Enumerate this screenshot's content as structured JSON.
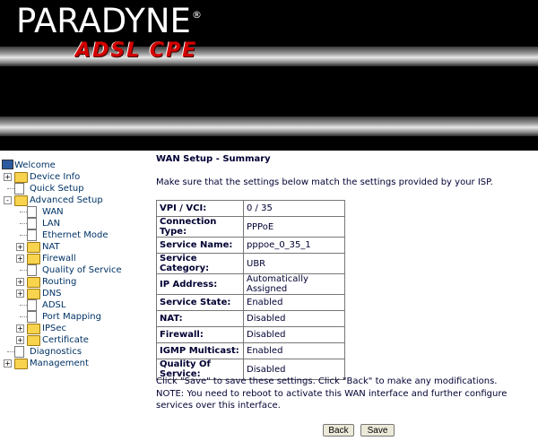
{
  "header": {
    "brand": "PARADYNE",
    "reg": "®",
    "product": "ADSL CPE"
  },
  "nav": {
    "items": [
      {
        "label": "Welcome",
        "kind": "root",
        "icon": "monitor-icon"
      },
      {
        "label": "Device Info",
        "kind": "folder",
        "expander": "+"
      },
      {
        "label": "Quick Setup",
        "kind": "doc"
      },
      {
        "label": "Advanced Setup",
        "kind": "folder-open",
        "expander": "-"
      },
      {
        "label": "WAN",
        "kind": "doc"
      },
      {
        "label": "LAN",
        "kind": "doc"
      },
      {
        "label": "Ethernet Mode",
        "kind": "doc"
      },
      {
        "label": "NAT",
        "kind": "folder",
        "expander": "+"
      },
      {
        "label": "Firewall",
        "kind": "folder",
        "expander": "+"
      },
      {
        "label": "Quality of Service",
        "kind": "doc"
      },
      {
        "label": "Routing",
        "kind": "folder",
        "expander": "+"
      },
      {
        "label": "DNS",
        "kind": "folder",
        "expander": "+"
      },
      {
        "label": "ADSL",
        "kind": "doc"
      },
      {
        "label": "Port Mapping",
        "kind": "doc"
      },
      {
        "label": "IPSec",
        "kind": "folder",
        "expander": "+"
      },
      {
        "label": "Certificate",
        "kind": "folder",
        "expander": "+"
      },
      {
        "label": "Diagnostics",
        "kind": "doc"
      },
      {
        "label": "Management",
        "kind": "folder",
        "expander": "+"
      }
    ]
  },
  "main": {
    "title": "WAN Setup - Summary",
    "intro": "Make sure that the settings below match the settings provided by your ISP.",
    "rows": [
      {
        "key": "VPI / VCI:",
        "value": "0 / 35"
      },
      {
        "key": "Connection Type:",
        "value": "PPPoE"
      },
      {
        "key": "Service Name:",
        "value": "pppoe_0_35_1"
      },
      {
        "key": "Service Category:",
        "value": "UBR"
      },
      {
        "key": "IP Address:",
        "value": "Automatically Assigned"
      },
      {
        "key": "Service State:",
        "value": "Enabled"
      },
      {
        "key": "NAT:",
        "value": "Disabled"
      },
      {
        "key": "Firewall:",
        "value": "Disabled"
      },
      {
        "key": "IGMP Multicast:",
        "value": "Enabled"
      },
      {
        "key": "Quality Of Service:",
        "value": "Disabled"
      }
    ],
    "note1": "Click \"Save\" to save these settings. Click \"Back\" to make any modifications.",
    "note2": "NOTE: You need to reboot to activate this WAN interface and further configure services over this interface.",
    "back_label": "Back",
    "save_label": "Save"
  }
}
